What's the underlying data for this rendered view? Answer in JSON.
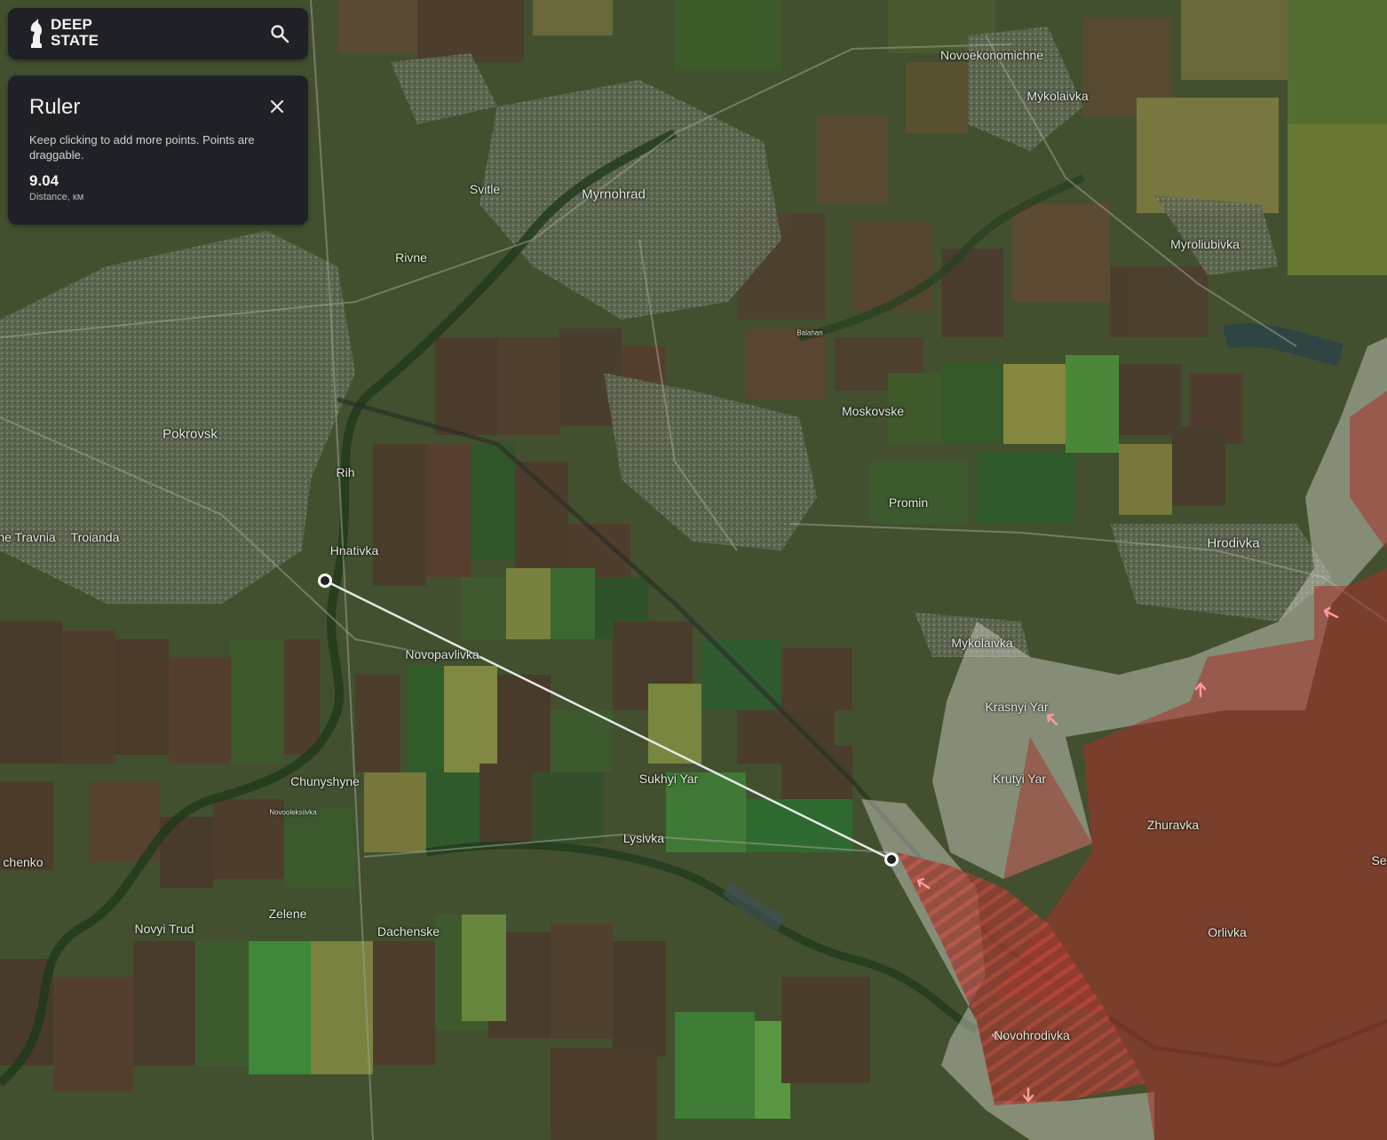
{
  "app": {
    "logo_text_line1": "DEEP",
    "logo_text_line2": "STATE",
    "logo_icon": "chess-knight-icon",
    "search_icon": "search-icon"
  },
  "ruler_panel": {
    "title": "Ruler",
    "close_icon": "close-icon",
    "hint": "Keep clicking to add more points. Points are draggable.",
    "distance_value": "9.04",
    "distance_label": "Distance, км"
  },
  "map": {
    "places": [
      {
        "id": "novoekonomichne",
        "label": "Novoekonomichne"
      },
      {
        "id": "mykolaivka-n",
        "label": "Mykolaivka"
      },
      {
        "id": "svitle",
        "label": "Svitle"
      },
      {
        "id": "myrnohrad",
        "label": "Myrnohrad"
      },
      {
        "id": "myroliubivka",
        "label": "Myroliubivka"
      },
      {
        "id": "rivne",
        "label": "Rivne"
      },
      {
        "id": "balahan",
        "label": "Balahan"
      },
      {
        "id": "moskovske",
        "label": "Moskovske"
      },
      {
        "id": "pokrovsk",
        "label": "Pokrovsk"
      },
      {
        "id": "rih",
        "label": "Rih"
      },
      {
        "id": "promin",
        "label": "Promin"
      },
      {
        "id": "travnia",
        "label": "ne Travnia"
      },
      {
        "id": "troianda",
        "label": "Troianda"
      },
      {
        "id": "hnativka",
        "label": "Hnativka"
      },
      {
        "id": "hrodivka",
        "label": "Hrodivka"
      },
      {
        "id": "mykolaivka-s",
        "label": "Mykolaivka"
      },
      {
        "id": "novopavlivka",
        "label": "Novopavlivka"
      },
      {
        "id": "krasnyi-yar",
        "label": "Krasnyi Yar"
      },
      {
        "id": "krutyi-yar",
        "label": "Krutyi Yar"
      },
      {
        "id": "chunyshyne",
        "label": "Chunyshyne"
      },
      {
        "id": "sukhyi-yar",
        "label": "Sukhyi Yar"
      },
      {
        "id": "novooleksiivka",
        "label": "Novooleksiivka"
      },
      {
        "id": "zhuravka",
        "label": "Zhuravka"
      },
      {
        "id": "lysivka",
        "label": "Lysivka"
      },
      {
        "id": "chenko",
        "label": "chenko"
      },
      {
        "id": "se",
        "label": "Se"
      },
      {
        "id": "zelene",
        "label": "Zelene"
      },
      {
        "id": "novyi-trud",
        "label": "Novyi Trud"
      },
      {
        "id": "dachenske",
        "label": "Dachenske"
      },
      {
        "id": "orlivka",
        "label": "Orlivka"
      },
      {
        "id": "novohrodivka",
        "label": "Novohrodivka"
      }
    ],
    "colors": {
      "occupied": "#a5312a",
      "contested": "#d8d8d0",
      "ruler_line": "#e8e8e8",
      "arrow": "#ff9aa0"
    }
  }
}
